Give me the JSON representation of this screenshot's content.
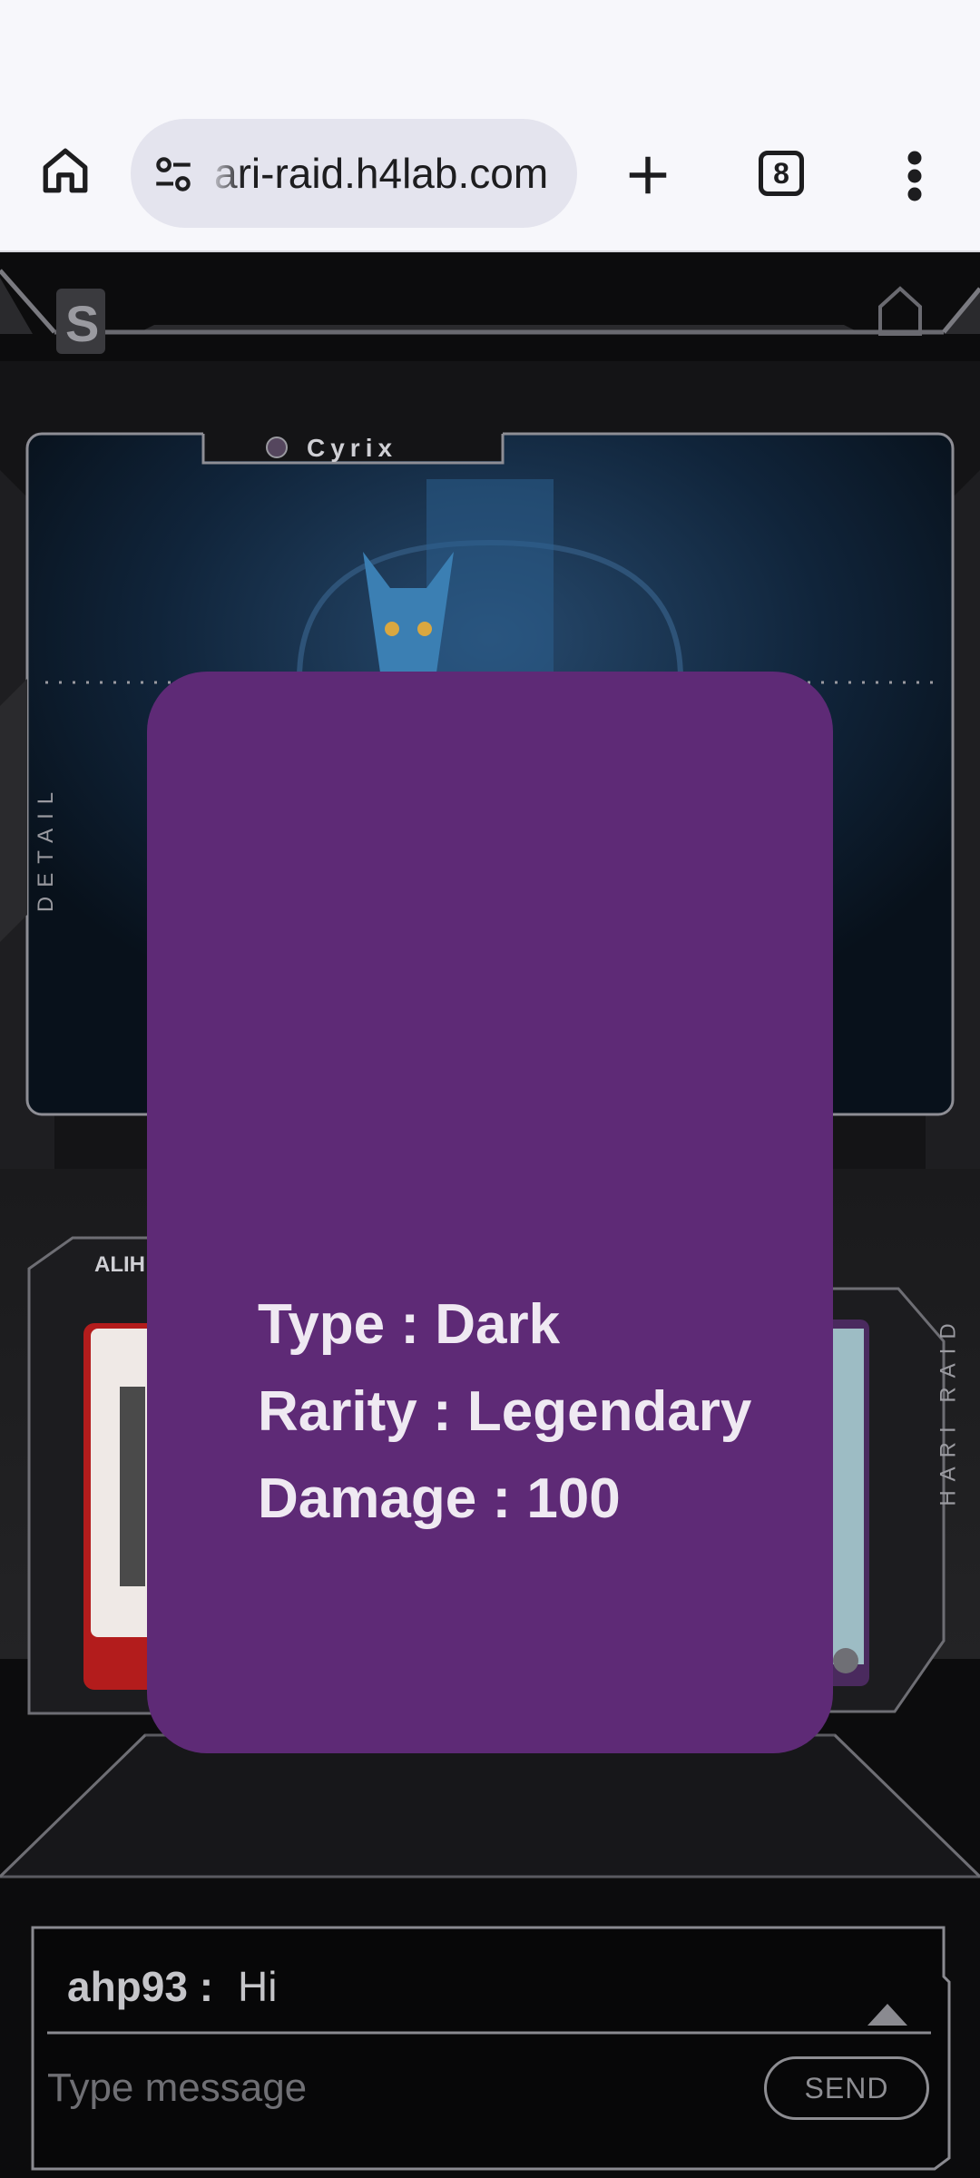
{
  "browser": {
    "url": "ari-raid.h4lab.com",
    "tab_count": "8"
  },
  "game": {
    "featured_card": {
      "name": "Cyrix"
    },
    "left_label": "DETAIL",
    "right_label": "HARI RAID",
    "left_card_label": "ALIH",
    "overlay": {
      "type_label": "Type",
      "type_value": "Dark",
      "rarity_label": "Rarity",
      "rarity_value": "Legendary",
      "damage_label": "Damage",
      "damage_value": "100",
      "bg_color": "#5e2a76"
    }
  },
  "chat": {
    "messages": [
      {
        "user": "ahp93",
        "text": "Hi"
      }
    ],
    "input_placeholder": "Type message",
    "send_label": "SEND"
  }
}
